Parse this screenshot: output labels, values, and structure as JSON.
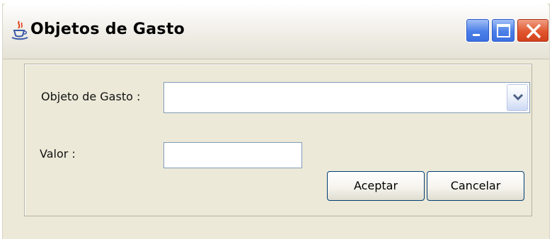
{
  "window": {
    "title": "Objetos de Gasto",
    "app_icon": "java-cup-icon",
    "controls": {
      "minimize": "minimize-icon",
      "maximize": "maximize-icon",
      "close": "close-icon"
    }
  },
  "form": {
    "objeto_label": "Objeto de Gasto :",
    "objeto_value": "",
    "valor_label": "Valor :",
    "valor_value": "",
    "aceptar_label": "Aceptar",
    "cancelar_label": "Cancelar"
  },
  "colors": {
    "title_button_blue": "#4b7fe8",
    "close_button_red": "#e1572f",
    "window_bg": "#ece9d8",
    "button_border": "#003c74",
    "field_border": "#7f9db9"
  }
}
